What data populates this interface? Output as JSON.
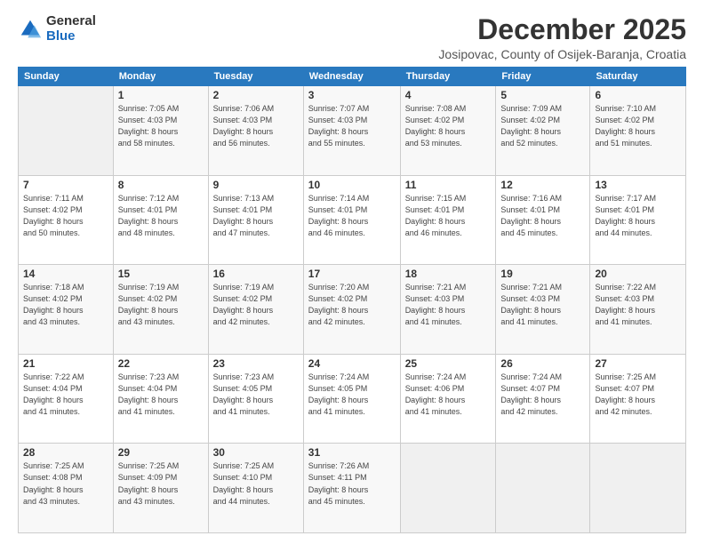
{
  "logo": {
    "general": "General",
    "blue": "Blue"
  },
  "header": {
    "month": "December 2025",
    "location": "Josipovac, County of Osijek-Baranja, Croatia"
  },
  "weekdays": [
    "Sunday",
    "Monday",
    "Tuesday",
    "Wednesday",
    "Thursday",
    "Friday",
    "Saturday"
  ],
  "weeks": [
    [
      {
        "day": "",
        "info": ""
      },
      {
        "day": "1",
        "info": "Sunrise: 7:05 AM\nSunset: 4:03 PM\nDaylight: 8 hours\nand 58 minutes."
      },
      {
        "day": "2",
        "info": "Sunrise: 7:06 AM\nSunset: 4:03 PM\nDaylight: 8 hours\nand 56 minutes."
      },
      {
        "day": "3",
        "info": "Sunrise: 7:07 AM\nSunset: 4:03 PM\nDaylight: 8 hours\nand 55 minutes."
      },
      {
        "day": "4",
        "info": "Sunrise: 7:08 AM\nSunset: 4:02 PM\nDaylight: 8 hours\nand 53 minutes."
      },
      {
        "day": "5",
        "info": "Sunrise: 7:09 AM\nSunset: 4:02 PM\nDaylight: 8 hours\nand 52 minutes."
      },
      {
        "day": "6",
        "info": "Sunrise: 7:10 AM\nSunset: 4:02 PM\nDaylight: 8 hours\nand 51 minutes."
      }
    ],
    [
      {
        "day": "7",
        "info": "Sunrise: 7:11 AM\nSunset: 4:02 PM\nDaylight: 8 hours\nand 50 minutes."
      },
      {
        "day": "8",
        "info": "Sunrise: 7:12 AM\nSunset: 4:01 PM\nDaylight: 8 hours\nand 48 minutes."
      },
      {
        "day": "9",
        "info": "Sunrise: 7:13 AM\nSunset: 4:01 PM\nDaylight: 8 hours\nand 47 minutes."
      },
      {
        "day": "10",
        "info": "Sunrise: 7:14 AM\nSunset: 4:01 PM\nDaylight: 8 hours\nand 46 minutes."
      },
      {
        "day": "11",
        "info": "Sunrise: 7:15 AM\nSunset: 4:01 PM\nDaylight: 8 hours\nand 46 minutes."
      },
      {
        "day": "12",
        "info": "Sunrise: 7:16 AM\nSunset: 4:01 PM\nDaylight: 8 hours\nand 45 minutes."
      },
      {
        "day": "13",
        "info": "Sunrise: 7:17 AM\nSunset: 4:01 PM\nDaylight: 8 hours\nand 44 minutes."
      }
    ],
    [
      {
        "day": "14",
        "info": "Sunrise: 7:18 AM\nSunset: 4:02 PM\nDaylight: 8 hours\nand 43 minutes."
      },
      {
        "day": "15",
        "info": "Sunrise: 7:19 AM\nSunset: 4:02 PM\nDaylight: 8 hours\nand 43 minutes."
      },
      {
        "day": "16",
        "info": "Sunrise: 7:19 AM\nSunset: 4:02 PM\nDaylight: 8 hours\nand 42 minutes."
      },
      {
        "day": "17",
        "info": "Sunrise: 7:20 AM\nSunset: 4:02 PM\nDaylight: 8 hours\nand 42 minutes."
      },
      {
        "day": "18",
        "info": "Sunrise: 7:21 AM\nSunset: 4:03 PM\nDaylight: 8 hours\nand 41 minutes."
      },
      {
        "day": "19",
        "info": "Sunrise: 7:21 AM\nSunset: 4:03 PM\nDaylight: 8 hours\nand 41 minutes."
      },
      {
        "day": "20",
        "info": "Sunrise: 7:22 AM\nSunset: 4:03 PM\nDaylight: 8 hours\nand 41 minutes."
      }
    ],
    [
      {
        "day": "21",
        "info": "Sunrise: 7:22 AM\nSunset: 4:04 PM\nDaylight: 8 hours\nand 41 minutes."
      },
      {
        "day": "22",
        "info": "Sunrise: 7:23 AM\nSunset: 4:04 PM\nDaylight: 8 hours\nand 41 minutes."
      },
      {
        "day": "23",
        "info": "Sunrise: 7:23 AM\nSunset: 4:05 PM\nDaylight: 8 hours\nand 41 minutes."
      },
      {
        "day": "24",
        "info": "Sunrise: 7:24 AM\nSunset: 4:05 PM\nDaylight: 8 hours\nand 41 minutes."
      },
      {
        "day": "25",
        "info": "Sunrise: 7:24 AM\nSunset: 4:06 PM\nDaylight: 8 hours\nand 41 minutes."
      },
      {
        "day": "26",
        "info": "Sunrise: 7:24 AM\nSunset: 4:07 PM\nDaylight: 8 hours\nand 42 minutes."
      },
      {
        "day": "27",
        "info": "Sunrise: 7:25 AM\nSunset: 4:07 PM\nDaylight: 8 hours\nand 42 minutes."
      }
    ],
    [
      {
        "day": "28",
        "info": "Sunrise: 7:25 AM\nSunset: 4:08 PM\nDaylight: 8 hours\nand 43 minutes."
      },
      {
        "day": "29",
        "info": "Sunrise: 7:25 AM\nSunset: 4:09 PM\nDaylight: 8 hours\nand 43 minutes."
      },
      {
        "day": "30",
        "info": "Sunrise: 7:25 AM\nSunset: 4:10 PM\nDaylight: 8 hours\nand 44 minutes."
      },
      {
        "day": "31",
        "info": "Sunrise: 7:26 AM\nSunset: 4:11 PM\nDaylight: 8 hours\nand 45 minutes."
      },
      {
        "day": "",
        "info": ""
      },
      {
        "day": "",
        "info": ""
      },
      {
        "day": "",
        "info": ""
      }
    ]
  ]
}
